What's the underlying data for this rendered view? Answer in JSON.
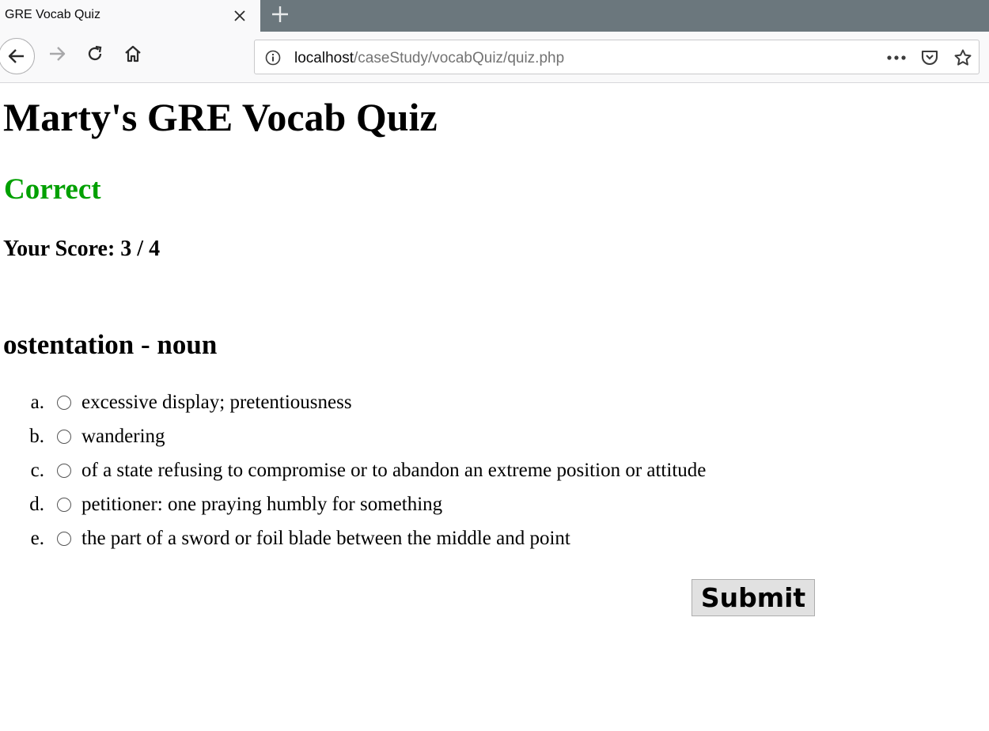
{
  "browser": {
    "tab_title": "GRE Vocab Quiz",
    "url_host": "localhost",
    "url_path": "/caseStudy/vocabQuiz/quiz.php",
    "icons": [
      "close-icon",
      "plus-icon",
      "back-arrow-icon",
      "forward-arrow-icon",
      "reload-icon",
      "home-icon",
      "info-icon",
      "more-actions-icon",
      "pocket-icon",
      "star-icon"
    ]
  },
  "page": {
    "title": "Marty's GRE Vocab Quiz",
    "result": "Correct",
    "result_color": "#00a000",
    "score": "Your Score: 3 / 4",
    "word": "ostentation - noun",
    "choices": [
      {
        "letter": "a.",
        "text": "excessive display; pretentiousness"
      },
      {
        "letter": "b.",
        "text": "wandering"
      },
      {
        "letter": "c.",
        "text": "of a state refusing to compromise or to abandon an extreme position or attitude"
      },
      {
        "letter": "d.",
        "text": "petitioner: one praying humbly for something"
      },
      {
        "letter": "e.",
        "text": "the part of a sword or foil blade between the middle and point"
      }
    ],
    "submit_label": "Submit"
  }
}
